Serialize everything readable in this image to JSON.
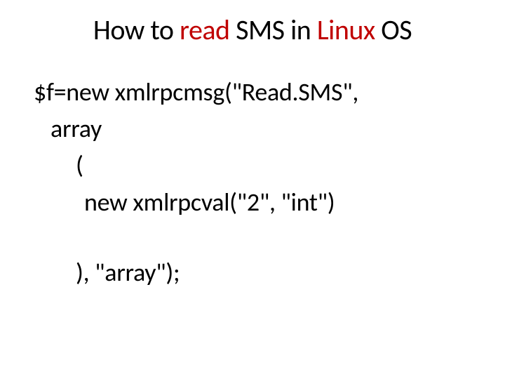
{
  "title": {
    "part1": "How to ",
    "part2": "read",
    "part3": " SMS in ",
    "part4": "Linux",
    "part5": " OS"
  },
  "code": {
    "line1": "$f=new xmlrpcmsg(\"Read.SMS\",",
    "line2": "array",
    "line3": "(",
    "line4": "new xmlrpcval(\"2\", \"int\")",
    "line5": "), \"array\");"
  }
}
